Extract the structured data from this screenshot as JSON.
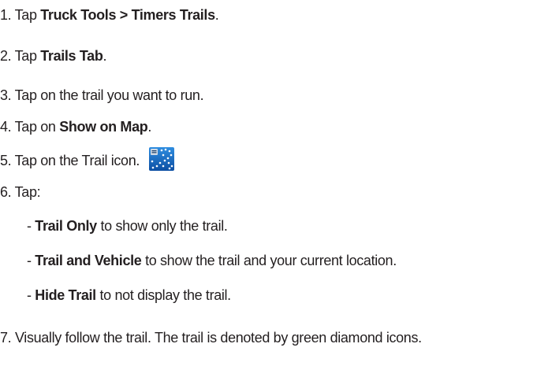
{
  "steps": {
    "s1": {
      "prefix": "1. Tap ",
      "bold": "Truck Tools > Timers Trails",
      "suffix": "."
    },
    "s2": {
      "prefix": "2. Tap ",
      "bold": "Trails Tab",
      "suffix": "."
    },
    "s3": {
      "text": "3. Tap on the trail you want to run."
    },
    "s4": {
      "prefix": "4. Tap on ",
      "bold": "Show on Map",
      "suffix": "."
    },
    "s5": {
      "text": "5. Tap on the Trail icon.",
      "icon": "trail-icon"
    },
    "s6": {
      "text": "6. Tap:"
    },
    "o1": {
      "prefix": "- ",
      "bold": "Trail Only",
      "suffix": " to show only the trail."
    },
    "o2": {
      "prefix": "- ",
      "bold": "Trail and Vehicle",
      "suffix": " to show the trail and your current location."
    },
    "o3": {
      "prefix": "- ",
      "bold": "Hide Trail",
      "suffix": " to not display the trail."
    },
    "s7": {
      "text": "7. Visually follow the trail. The trail is denoted by green diamond icons."
    }
  },
  "colors": {
    "text": "#231f20",
    "icon_bg": "#1565c0",
    "icon_dots": "#ffffff"
  }
}
